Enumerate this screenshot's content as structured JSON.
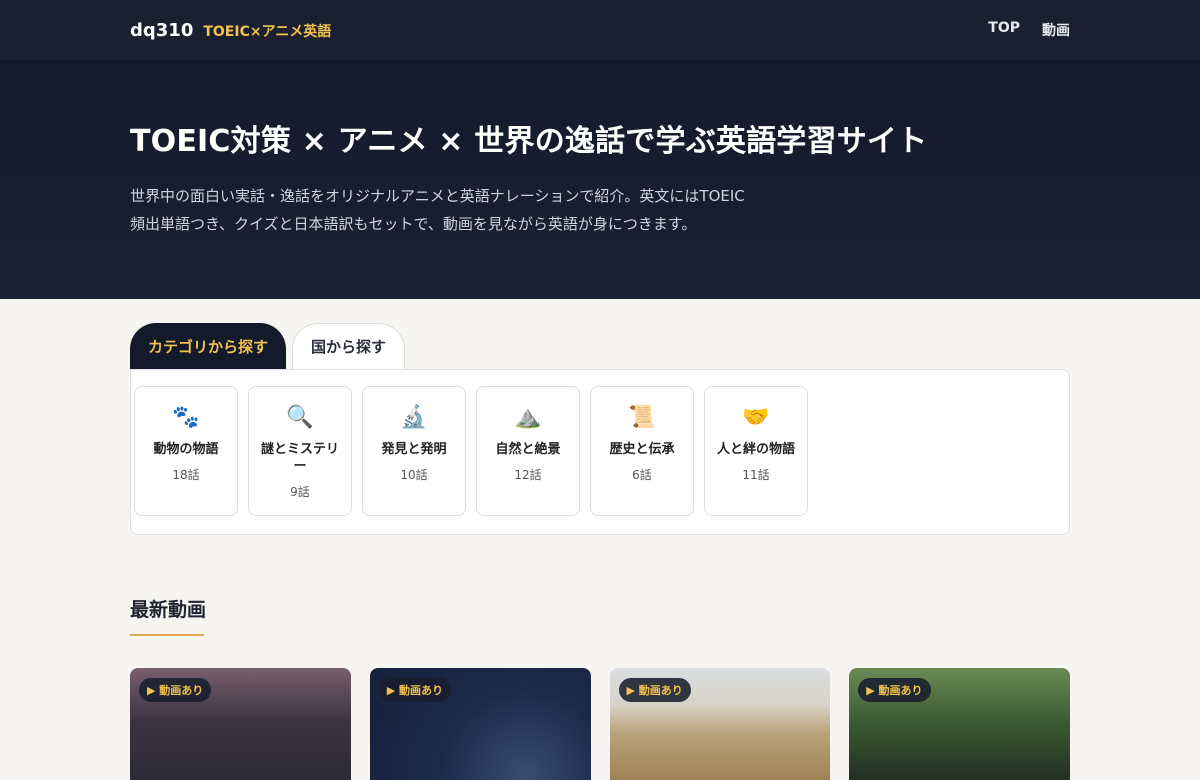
{
  "header": {
    "brand": "dq310",
    "subtitle": "TOEIC×アニメ英語",
    "nav": [
      "TOP",
      "動画"
    ]
  },
  "hero": {
    "title": "TOEIC対策 × アニメ × 世界の逸話で学ぶ英語学習サイト",
    "description": "世界中の面白い実話・逸話をオリジナルアニメと英語ナレーションで紹介。英文にはTOEIC頻出単語つき、クイズと日本語訳もセットで、動画を見ながら英語が身につきます。"
  },
  "tabs": [
    {
      "label": "カテゴリから探す",
      "active": true
    },
    {
      "label": "国から探す",
      "active": false
    }
  ],
  "categories": [
    {
      "icon": "🐾",
      "icon_name": "paw-icon",
      "name": "動物の物語",
      "count": "18話"
    },
    {
      "icon": "🔍",
      "icon_name": "magnifier-icon",
      "name": "謎とミステリー",
      "count": "9話"
    },
    {
      "icon": "🔬",
      "icon_name": "microscope-icon",
      "name": "発見と発明",
      "count": "10話"
    },
    {
      "icon": "⛰️",
      "icon_name": "mountain-icon",
      "name": "自然と絶景",
      "count": "12話"
    },
    {
      "icon": "📜",
      "icon_name": "scroll-icon",
      "name": "歴史と伝承",
      "count": "6話"
    },
    {
      "icon": "🤝",
      "icon_name": "handshake-icon",
      "name": "人と絆の物語",
      "count": "11話"
    }
  ],
  "latest": {
    "title": "最新動画",
    "badge": "▶ 動画あり"
  },
  "colors": {
    "accent": "#f2c14e",
    "header_bg": "#1a2030",
    "hero_bg": "#131a2b",
    "underline": "#e0a94a"
  }
}
